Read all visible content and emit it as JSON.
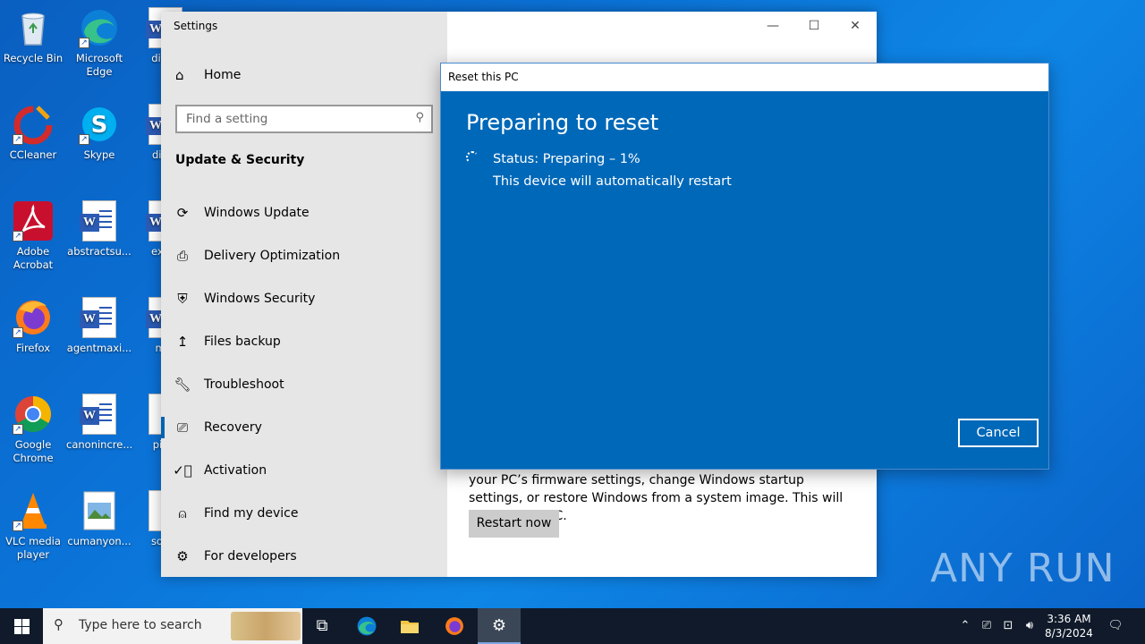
{
  "desktop": {
    "icons": [
      {
        "label": "Recycle Bin"
      },
      {
        "label": "Microsoft Edge"
      },
      {
        "label": "dictio"
      },
      {
        "label": "CCleaner"
      },
      {
        "label": "Skype"
      },
      {
        "label": "discu"
      },
      {
        "label": "Adobe Acrobat"
      },
      {
        "label": "abstractsu..."
      },
      {
        "label": "exam"
      },
      {
        "label": "Firefox"
      },
      {
        "label": "agentmaxi..."
      },
      {
        "label": "mar"
      },
      {
        "label": "Google Chrome"
      },
      {
        "label": "canonincre..."
      },
      {
        "label": "pictu"
      },
      {
        "label": "VLC media player"
      },
      {
        "label": "cumanyon..."
      },
      {
        "label": "south"
      }
    ]
  },
  "settings": {
    "title": "Settings",
    "home_label": "Home",
    "search_placeholder": "Find a setting",
    "section_title": "Update & Security",
    "nav": [
      {
        "label": "Windows Update",
        "icon": "sync-icon"
      },
      {
        "label": "Delivery Optimization",
        "icon": "delivery-icon"
      },
      {
        "label": "Windows Security",
        "icon": "shield-icon"
      },
      {
        "label": "Files backup",
        "icon": "backup-icon"
      },
      {
        "label": "Troubleshoot",
        "icon": "wrench-icon"
      },
      {
        "label": "Recovery",
        "icon": "recovery-icon"
      },
      {
        "label": "Activation",
        "icon": "check-circle-icon"
      },
      {
        "label": "Find my device",
        "icon": "person-pin-icon"
      },
      {
        "label": "For developers",
        "icon": "developer-icon"
      }
    ],
    "content_text": "your PC’s firmware settings, change Windows startup settings, or restore Windows from a system image. This will restart your PC.",
    "restart_label": "Restart now"
  },
  "reset_dialog": {
    "title": "Reset this PC",
    "heading": "Preparing to reset",
    "status": "Status: Preparing – 1%",
    "status_detail": "This device will automatically restart",
    "cancel_label": "Cancel",
    "bg_color": "#0068b8"
  },
  "watermark": "ANY RUN",
  "taskbar": {
    "search_placeholder": "Type here to search",
    "time": "3:36 AM",
    "date": "8/3/2024"
  }
}
